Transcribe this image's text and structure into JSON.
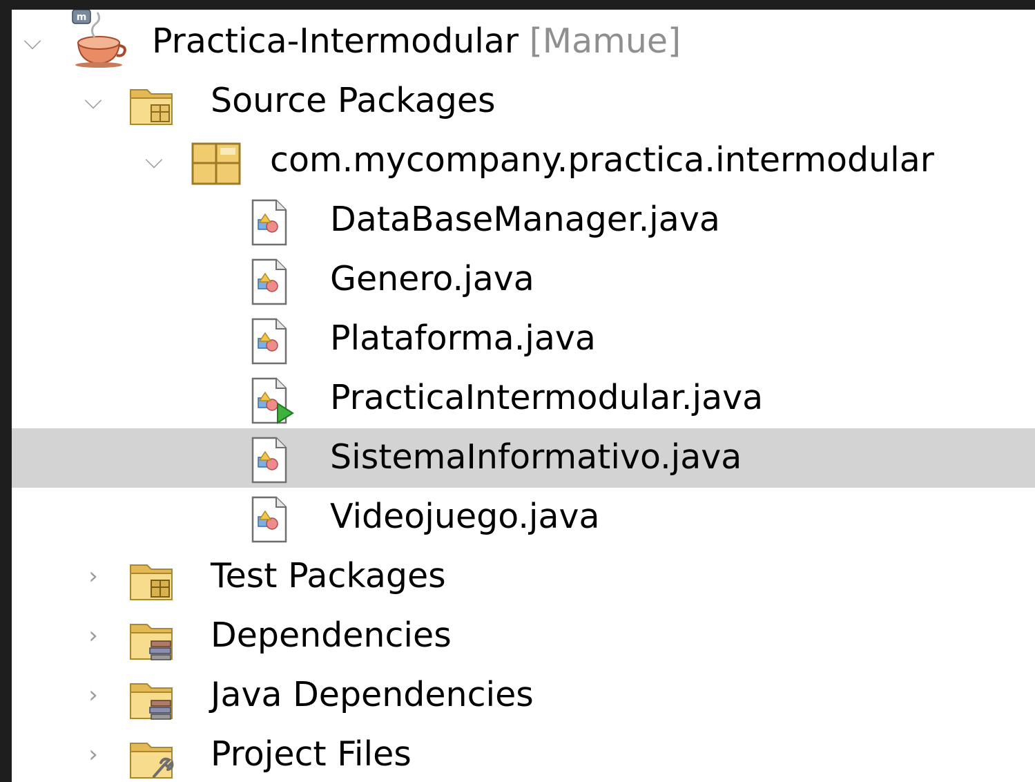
{
  "project": {
    "name": "Practica-Intermodular",
    "branch": "[Mamue]",
    "expanded": true
  },
  "source_packages": {
    "label": "Source Packages",
    "expanded": true,
    "package": {
      "name": "com.mycompany.practica.intermodular",
      "expanded": true,
      "files": [
        {
          "name": "DataBaseManager.java",
          "icon": "java-class-icon"
        },
        {
          "name": "Genero.java",
          "icon": "java-class-icon"
        },
        {
          "name": "Plataforma.java",
          "icon": "java-class-icon"
        },
        {
          "name": "PracticaIntermodular.java",
          "icon": "java-main-class-icon"
        },
        {
          "name": "SistemaInformativo.java",
          "icon": "java-class-icon",
          "selected": true
        },
        {
          "name": "Videojuego.java",
          "icon": "java-class-icon"
        }
      ]
    }
  },
  "other_nodes": [
    {
      "label": "Test Packages",
      "icon": "test-packages-folder-icon",
      "expanded": false
    },
    {
      "label": "Dependencies",
      "icon": "dependencies-folder-icon",
      "expanded": false
    },
    {
      "label": "Java Dependencies",
      "icon": "java-dependencies-folder-icon",
      "expanded": false
    },
    {
      "label": "Project Files",
      "icon": "project-files-folder-icon",
      "expanded": false
    }
  ],
  "colors": {
    "background": "#ffffff",
    "selection": "#d3d3d3",
    "branch_text": "#8f8f8f",
    "folder": "#f2d27a",
    "run_arrow": "#3db33d"
  },
  "icons": {
    "expanded": "chevron-down-icon",
    "collapsed": "chevron-right-icon"
  }
}
